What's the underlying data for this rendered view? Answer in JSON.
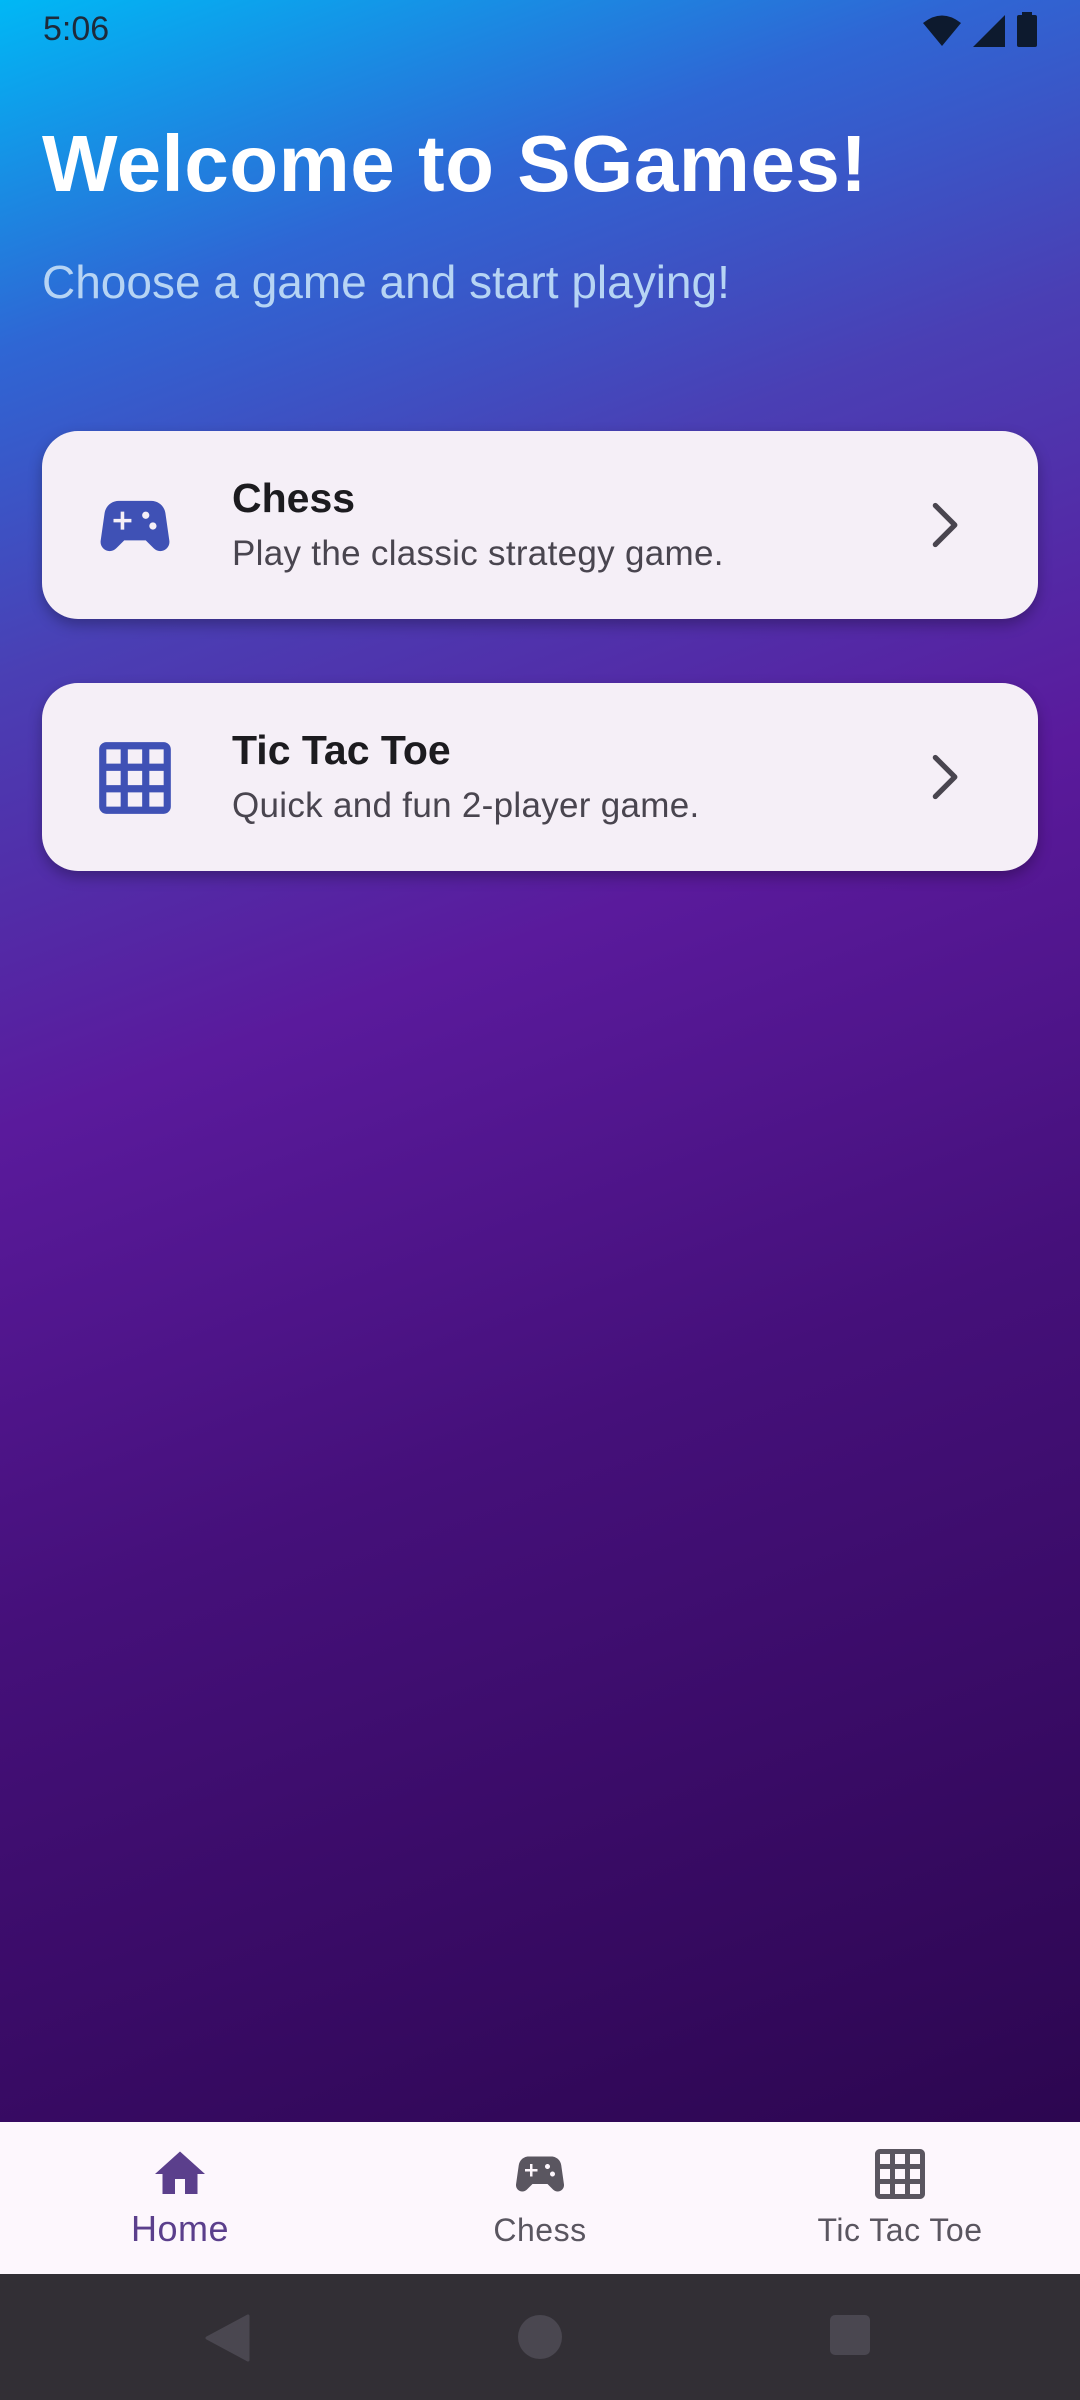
{
  "status_bar": {
    "time": "5:06",
    "icons": [
      "wifi-icon",
      "signal-icon",
      "battery-icon"
    ]
  },
  "header": {
    "title": "Welcome to SGames!",
    "subtitle": "Choose a game and start playing!"
  },
  "games": [
    {
      "title": "Chess",
      "description": "Play the classic strategy game.",
      "icon": "gamepad-icon"
    },
    {
      "title": "Tic Tac Toe",
      "description": "Quick and fun 2-player game.",
      "icon": "grid-icon"
    }
  ],
  "bottom_nav": {
    "items": [
      {
        "label": "Home",
        "icon": "home-icon",
        "active": true
      },
      {
        "label": "Chess",
        "icon": "gamepad-icon",
        "active": false
      },
      {
        "label": "Tic Tac Toe",
        "icon": "grid-icon",
        "active": false
      }
    ]
  },
  "colors": {
    "accent": "#3f51b5",
    "nav_active": "#5b3f8c",
    "card_bg": "#f5eff7",
    "gradient_top": "#00b8f5",
    "gradient_mid": "#5a1a9c",
    "gradient_bottom": "#2c0650"
  }
}
